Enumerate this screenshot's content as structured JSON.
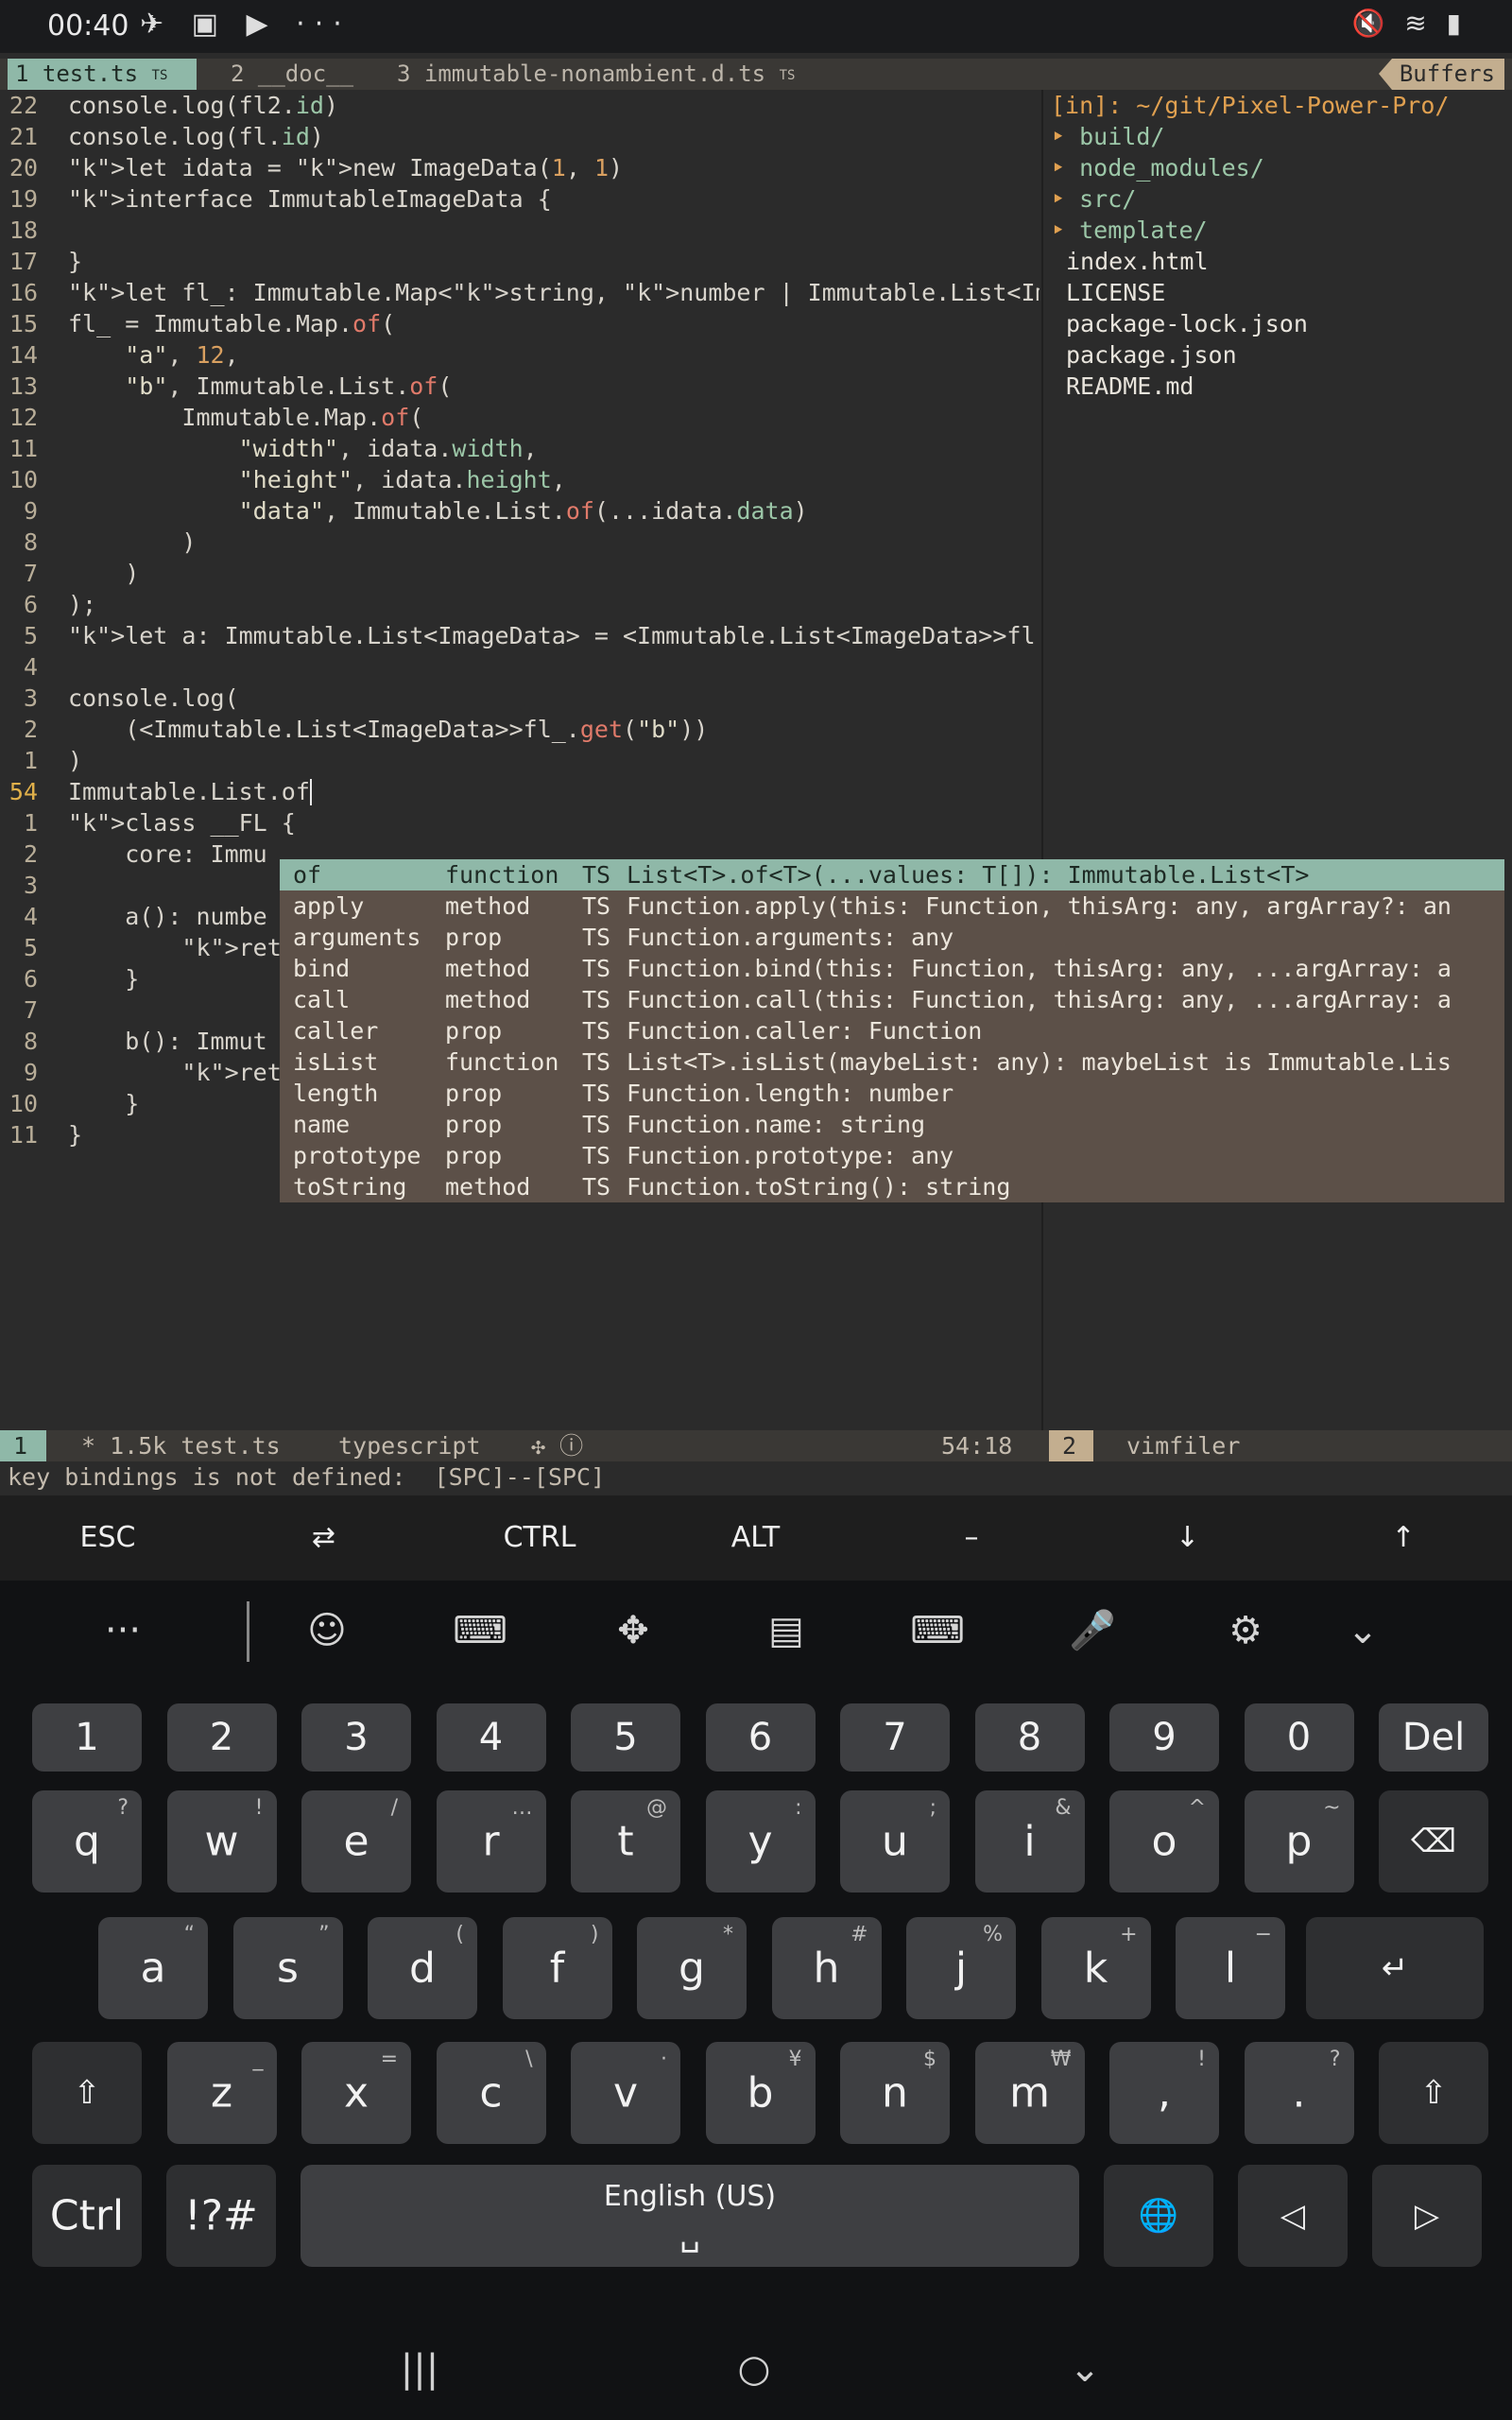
{
  "status_bar": {
    "time": "00:40",
    "left_icons": "✈ ▣ ▶ ···",
    "right_icons": "🔇 ≋ ▮"
  },
  "tabline": {
    "tab1_num": "1",
    "tab1_name": "test.ts",
    "tab1_mark": "TS",
    "tab2": "2 __doc__",
    "tab3": "3 immutable-nonambient.d.ts",
    "tab3_mark": "TS",
    "buffers_label": "Buffers"
  },
  "editor_lines": [
    {
      "n": "22",
      "code": "console.log(fl2.id)"
    },
    {
      "n": "21",
      "code": "console.log(fl.id)"
    },
    {
      "n": "20",
      "code": "let idata = new ImageData(1, 1)"
    },
    {
      "n": "19",
      "code": "interface ImmutableImageData {"
    },
    {
      "n": "18",
      "code": ""
    },
    {
      "n": "17",
      "code": "}"
    },
    {
      "n": "16",
      "code": "let fl_: Immutable.Map<string, number | Immutable.List<ImageData"
    },
    {
      "n": "15",
      "code": "fl_ = Immutable.Map.of("
    },
    {
      "n": "14",
      "code": "    \"a\", 12,"
    },
    {
      "n": "13",
      "code": "    \"b\", Immutable.List.of("
    },
    {
      "n": "12",
      "code": "        Immutable.Map.of("
    },
    {
      "n": "11",
      "code": "            \"width\", idata.width,"
    },
    {
      "n": "10",
      "code": "            \"height\", idata.height,"
    },
    {
      "n": "9",
      "code": "            \"data\", Immutable.List.of(...idata.data)"
    },
    {
      "n": "8",
      "code": "        )"
    },
    {
      "n": "7",
      "code": "    )"
    },
    {
      "n": "6",
      "code": ");"
    },
    {
      "n": "5",
      "code": "let a: Immutable.List<ImageData> = <Immutable.List<ImageData>>fl"
    },
    {
      "n": "4",
      "code": ""
    },
    {
      "n": "3",
      "code": "console.log("
    },
    {
      "n": "2",
      "code": "    (<Immutable.List<ImageData>>fl_.get(\"b\"))"
    },
    {
      "n": "1",
      "code": ")"
    },
    {
      "n": "54",
      "code": "Immutable.List.of"
    },
    {
      "n": "1",
      "code": "class __FL {"
    },
    {
      "n": "2",
      "code": "    core: Immu"
    },
    {
      "n": "3",
      "code": ""
    },
    {
      "n": "4",
      "code": "    a(): numbe"
    },
    {
      "n": "5",
      "code": "        return"
    },
    {
      "n": "6",
      "code": "    }"
    },
    {
      "n": "7",
      "code": ""
    },
    {
      "n": "8",
      "code": "    b(): Immut"
    },
    {
      "n": "9",
      "code": "        return"
    },
    {
      "n": "10",
      "code": "    }"
    },
    {
      "n": "11",
      "code": "}"
    }
  ],
  "filer": {
    "header": "[in]: ~/git/Pixel-Power-Pro/",
    "dirs": [
      "build/",
      "node_modules/",
      "src/",
      "template/"
    ],
    "files": [
      "index.html",
      "LICENSE",
      "package-lock.json",
      "package.json",
      "README.md"
    ]
  },
  "completion": [
    {
      "word": "of",
      "kind": "function",
      "src": "TS",
      "sig": "List<T>.of<T>(...values: T[]): Immutable.List<T>"
    },
    {
      "word": "apply",
      "kind": "method",
      "src": "TS",
      "sig": "Function.apply(this: Function, thisArg: any, argArray?: an"
    },
    {
      "word": "arguments",
      "kind": "prop",
      "src": "TS",
      "sig": "Function.arguments: any"
    },
    {
      "word": "bind",
      "kind": "method",
      "src": "TS",
      "sig": "Function.bind(this: Function, thisArg: any, ...argArray: a"
    },
    {
      "word": "call",
      "kind": "method",
      "src": "TS",
      "sig": "Function.call(this: Function, thisArg: any, ...argArray: a"
    },
    {
      "word": "caller",
      "kind": "prop",
      "src": "TS",
      "sig": "Function.caller: Function"
    },
    {
      "word": "isList",
      "kind": "function",
      "src": "TS",
      "sig": "List<T>.isList(maybeList: any): maybeList is Immutable.Lis"
    },
    {
      "word": "length",
      "kind": "prop",
      "src": "TS",
      "sig": "Function.length: number"
    },
    {
      "word": "name",
      "kind": "prop",
      "src": "TS",
      "sig": "Function.name: string"
    },
    {
      "word": "prototype",
      "kind": "prop",
      "src": "TS",
      "sig": "Function.prototype: any"
    },
    {
      "word": "toString",
      "kind": "method",
      "src": "TS",
      "sig": "Function.toString(): string"
    }
  ],
  "statusline": {
    "win1": "1",
    "file": "* 1.5k test.ts",
    "filetype": "typescript",
    "icons": "✣ ⓘ",
    "position": "54:18",
    "win2": "2",
    "win2_name": "vimfiler"
  },
  "cmdline": "key bindings is not defined:  [SPC]--[SPC]",
  "extra_keys": [
    "ESC",
    "⇄",
    "CTRL",
    "ALT",
    "–",
    "↓",
    "↑"
  ],
  "keyboard": {
    "toolbar": [
      "···",
      "☺",
      "⌨",
      "✥",
      "▤",
      "⌨",
      "🎤",
      "⚙",
      "⌄"
    ],
    "numbers": [
      "1",
      "2",
      "3",
      "4",
      "5",
      "6",
      "7",
      "8",
      "9",
      "0"
    ],
    "del_label": "Del",
    "row1": [
      {
        "k": "q",
        "s": "?"
      },
      {
        "k": "w",
        "s": "!"
      },
      {
        "k": "e",
        "s": "/"
      },
      {
        "k": "r",
        "s": "…"
      },
      {
        "k": "t",
        "s": "@"
      },
      {
        "k": "y",
        "s": ":"
      },
      {
        "k": "u",
        "s": ";"
      },
      {
        "k": "i",
        "s": "&"
      },
      {
        "k": "o",
        "s": "^"
      },
      {
        "k": "p",
        "s": "~"
      }
    ],
    "row2": [
      {
        "k": "a",
        "s": "“"
      },
      {
        "k": "s",
        "s": "”"
      },
      {
        "k": "d",
        "s": "("
      },
      {
        "k": "f",
        "s": ")"
      },
      {
        "k": "g",
        "s": "*"
      },
      {
        "k": "h",
        "s": "#"
      },
      {
        "k": "j",
        "s": "%"
      },
      {
        "k": "k",
        "s": "+"
      },
      {
        "k": "l",
        "s": "−"
      }
    ],
    "row3": [
      {
        "k": "z",
        "s": "_"
      },
      {
        "k": "x",
        "s": "="
      },
      {
        "k": "c",
        "s": "\\"
      },
      {
        "k": "v",
        "s": "·"
      },
      {
        "k": "b",
        "s": "¥"
      },
      {
        "k": "n",
        "s": "$"
      },
      {
        "k": "m",
        "s": "₩"
      }
    ],
    "comma": ",",
    "comma_sup": "!",
    "period": ".",
    "period_sup": "?",
    "ctrl_label": "Ctrl",
    "sym_label": "!?#",
    "space_label": "English (US)",
    "space_glyph": "␣"
  },
  "nav_bar": [
    "|||",
    "○",
    "⌄"
  ]
}
